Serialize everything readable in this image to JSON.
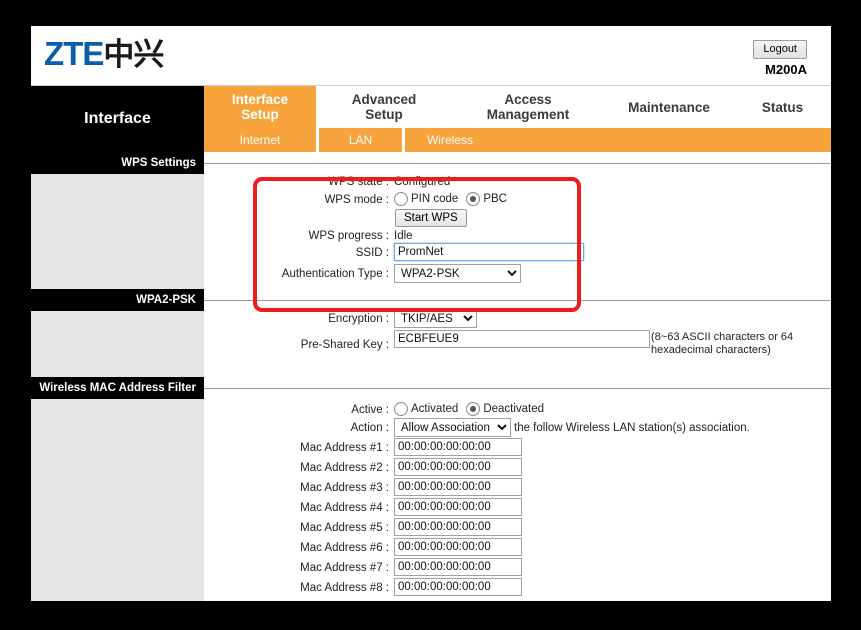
{
  "brand": {
    "logo_latin": "ZTE",
    "logo_cjk": "中兴",
    "model": "M200A",
    "logout_label": "Logout"
  },
  "nav": {
    "section_label": "Interface",
    "tabs": [
      {
        "label": "Interface\nSetup",
        "line1": "Interface",
        "line2": "Setup",
        "active": true
      },
      {
        "label": "Advanced\nSetup",
        "line1": "Advanced",
        "line2": "Setup",
        "active": false
      },
      {
        "label": "Access\nManagement",
        "line1": "Access",
        "line2": "Management",
        "active": false
      },
      {
        "label": "Maintenance",
        "line1": "Maintenance",
        "line2": "",
        "active": false
      },
      {
        "label": "Status",
        "line1": "Status",
        "line2": "",
        "active": false
      }
    ],
    "subtabs": [
      {
        "label": "Internet"
      },
      {
        "label": "LAN"
      },
      {
        "label": "Wireless"
      }
    ]
  },
  "sections": {
    "wps": {
      "header": "WPS Settings",
      "state_label": "WPS state :",
      "state_value": "Configured",
      "mode_label": "WPS mode :",
      "mode_options": [
        {
          "label": "PIN code",
          "selected": false
        },
        {
          "label": "PBC",
          "selected": true
        }
      ],
      "start_button": "Start WPS",
      "progress_label": "WPS progress :",
      "progress_value": "Idle",
      "ssid_label": "SSID :",
      "ssid_value": "PromNet",
      "auth_label": "Authentication Type :",
      "auth_value": "WPA2-PSK",
      "auth_options": [
        "WPA2-PSK"
      ]
    },
    "wpa2psk": {
      "header": "WPA2-PSK",
      "encryption_label": "Encryption :",
      "encryption_value": "TKIP/AES",
      "encryption_options": [
        "TKIP/AES"
      ],
      "psk_label": "Pre-Shared Key :",
      "psk_value": "ECBFEUE9",
      "psk_hint": "(8~63 ASCII characters or 64 hexadecimal characters)"
    },
    "macfilter": {
      "header": "Wireless MAC Address Filter",
      "active_label": "Active :",
      "active_options": [
        {
          "label": "Activated",
          "selected": false
        },
        {
          "label": "Deactivated",
          "selected": true
        }
      ],
      "action_label": "Action :",
      "action_value": "Allow Association",
      "action_options": [
        "Allow Association"
      ],
      "action_suffix": "the follow Wireless LAN station(s) association.",
      "mac_rows": [
        {
          "label": "Mac Address #1 :",
          "value": "00:00:00:00:00:00"
        },
        {
          "label": "Mac Address #2 :",
          "value": "00:00:00:00:00:00"
        },
        {
          "label": "Mac Address #3 :",
          "value": "00:00:00:00:00:00"
        },
        {
          "label": "Mac Address #4 :",
          "value": "00:00:00:00:00:00"
        },
        {
          "label": "Mac Address #5 :",
          "value": "00:00:00:00:00:00"
        },
        {
          "label": "Mac Address #6 :",
          "value": "00:00:00:00:00:00"
        },
        {
          "label": "Mac Address #7 :",
          "value": "00:00:00:00:00:00"
        },
        {
          "label": "Mac Address #8 :",
          "value": "00:00:00:00:00:00"
        }
      ]
    }
  },
  "annotation": {
    "color": "#ee1c1c"
  }
}
